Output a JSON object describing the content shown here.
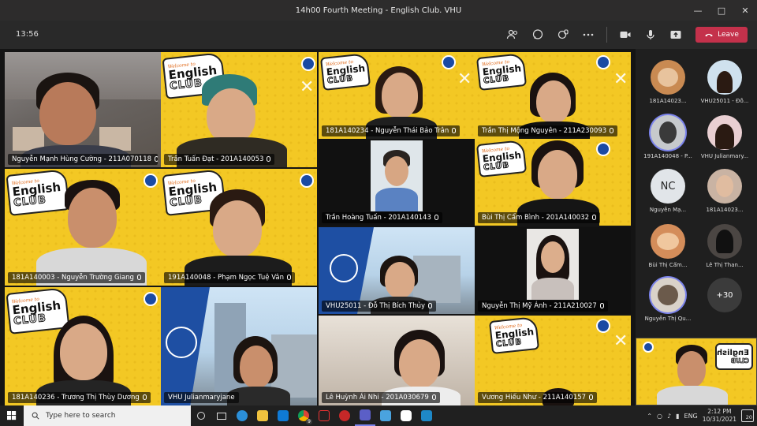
{
  "window": {
    "title": "14h00 Fourth Meeting - English Club. VHU"
  },
  "meeting": {
    "timer": "13:56",
    "leave_label": "Leave"
  },
  "logo": {
    "welcome": "Welcome to",
    "line1": "English",
    "line2": "CLUB"
  },
  "tiles": [
    {
      "name": "Nguyễn Mạnh Hùng Cường - 211A070118"
    },
    {
      "name": "Trần Tuấn Đạt - 201A140053"
    },
    {
      "name": "181A140234 - Nguyễn Thái Bảo Trân"
    },
    {
      "name": "Trần Thị Mộng Nguyên - 211A230093"
    },
    {
      "name": "Trần Hoàng Tuấn - 201A140143"
    },
    {
      "name": "Bùi Thị Cẩm Bình - 201A140032"
    },
    {
      "name": "181A140003 - Nguyễn Trường Giang"
    },
    {
      "name": "191A140048 - Phạm Ngọc Tuệ Vân"
    },
    {
      "name": "VHU25011 - Đỗ Thị Bích Thủy"
    },
    {
      "name": "Nguyễn Thị Mỹ Ánh - 211A210027"
    },
    {
      "name": "181A140236 - Trương Thị Thùy Dương"
    },
    {
      "name": "VHU Julianmaryjane"
    },
    {
      "name": "Lê Huỳnh Ái Nhi - 201A030679"
    },
    {
      "name": "Vương Hiếu Như - 211A140157"
    }
  ],
  "roster": [
    {
      "name": "181A14023..."
    },
    {
      "name": "VHU25011 - Đỗ..."
    },
    {
      "name": "191A140048 - P..."
    },
    {
      "name": "VHU Julianmary..."
    },
    {
      "name": "Nguyễn Mạ...",
      "initials": "NC"
    },
    {
      "name": "181A14023..."
    },
    {
      "name": "Bùi Thị Cẩm..."
    },
    {
      "name": "Lê Thị Than..."
    },
    {
      "name": "Nguyễn Thị Qu..."
    }
  ],
  "roster_more": "+30",
  "taskbar": {
    "search_placeholder": "Type here to search",
    "lang": "ENG",
    "time": "2:12 PM",
    "date": "10/31/2021",
    "notifications": "20",
    "badge": "9"
  },
  "colors": {
    "leave": "#c4314b",
    "club_yellow": "#f3c824",
    "teams_purple": "#7b83eb"
  }
}
